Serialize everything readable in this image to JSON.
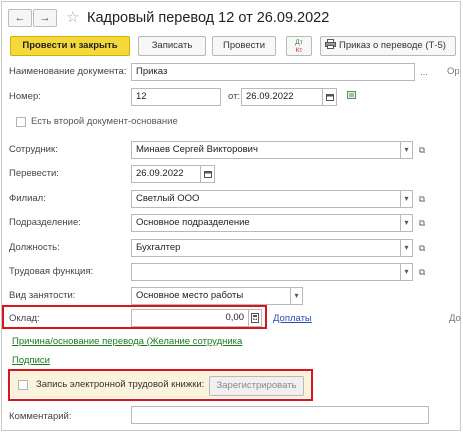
{
  "window": {
    "title": "Кадровый перевод 12 от 26.09.2022",
    "back_glyph": "←",
    "forward_glyph": "→",
    "favorite_glyph": "☆"
  },
  "toolbar": {
    "post_and_close": "Провести и закрыть",
    "save": "Записать",
    "post": "Провести",
    "dtkt_top": "Дт",
    "dtkt_bottom": "Кт",
    "print_order": "Приказ о переводе (Т-5)"
  },
  "form": {
    "doc_name_label": "Наименование документа:",
    "doc_name_value": "Приказ",
    "doc_name_suffix": "Ор",
    "number_label": "Номер:",
    "number_value": "12",
    "date_label": "от:",
    "date_value": "26.09.2022",
    "second_basis_label": "Есть второй документ-основание",
    "employee_label": "Сотрудник:",
    "employee_value": "Минаев Сергей Викторович",
    "transfer_label": "Перевести:",
    "transfer_value": "26.09.2022",
    "branch_label": "Филиал:",
    "branch_value": "Светлый ООО",
    "department_label": "Подразделение:",
    "department_value": "Основное подразделение",
    "position_label": "Должность:",
    "position_value": "Бухгалтер",
    "labor_function_label": "Трудовая функция:",
    "labor_function_value": "",
    "employment_type_label": "Вид занятости:",
    "employment_type_value": "Основное место работы",
    "salary_label": "Оклад:",
    "salary_value": "0,00",
    "allowances_link": "Доплаты",
    "salary_right_cut": "До",
    "reason_link": "Причина/основание перевода (Желание сотрудника",
    "signatures_link": "Подписи",
    "electronic_book_label": "Запись электронной трудовой книжки:",
    "register_button": "Зарегистрировать",
    "comment_label": "Комментарий:",
    "comment_value": ""
  },
  "colors": {
    "primary_button": "#f5d83a",
    "highlight_border": "#d9151b",
    "link_blue": "#2a4bb5",
    "link_green": "#1d7a22"
  }
}
